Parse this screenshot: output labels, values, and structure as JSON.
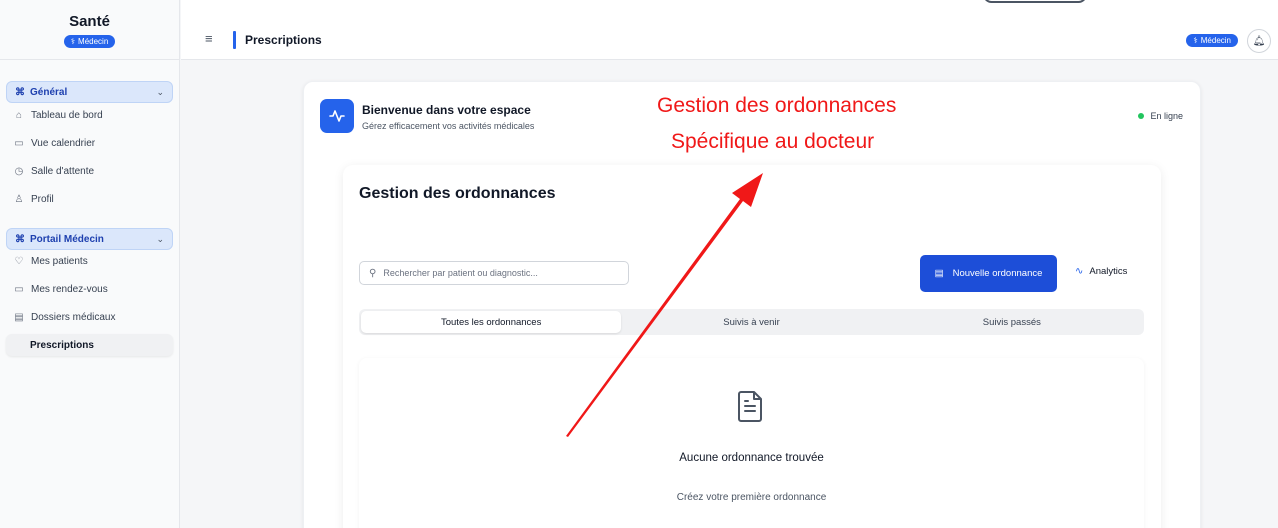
{
  "sidebar": {
    "brand": "Santé",
    "role_badge": "Médecin",
    "groups": [
      {
        "label": "Général",
        "items": [
          {
            "label": "Tableau de bord",
            "icon": "home-icon"
          },
          {
            "label": "Vue calendrier",
            "icon": "calendar-icon"
          },
          {
            "label": "Salle d'attente",
            "icon": "clock-icon"
          },
          {
            "label": "Profil",
            "icon": "user-icon"
          }
        ]
      },
      {
        "label": "Portail Médecin",
        "items": [
          {
            "label": "Mes patients",
            "icon": "heart-icon"
          },
          {
            "label": "Mes rendez-vous",
            "icon": "calendar-icon"
          },
          {
            "label": "Dossiers médicaux",
            "icon": "file-icon"
          },
          {
            "label": "Prescriptions",
            "icon": "pill-icon",
            "active": true
          }
        ]
      }
    ]
  },
  "topbar": {
    "title": "Prescriptions",
    "role_badge": "Médecin"
  },
  "welcome": {
    "title": "Bienvenue dans votre espace",
    "subtitle": "Gérez efficacement vos activités médicales",
    "status": "En ligne"
  },
  "prescriptions": {
    "title": "Gestion des ordonnances",
    "search_placeholder": "Rechercher par patient ou diagnostic...",
    "new_button": "Nouvelle ordonnance",
    "analytics": "Analytics",
    "tabs": [
      "Toutes les ordonnances",
      "Suivis à venir",
      "Suivis passés"
    ],
    "active_tab": 0,
    "empty_title": "Aucune ordonnance trouvée",
    "empty_subtitle": "Créez votre première ordonnance"
  },
  "annotation": {
    "line1": "Gestion des ordonnances",
    "line2": "Spécifique au docteur",
    "color": "#f01818"
  },
  "colors": {
    "accent": "#2563eb",
    "online": "#22c55e"
  }
}
